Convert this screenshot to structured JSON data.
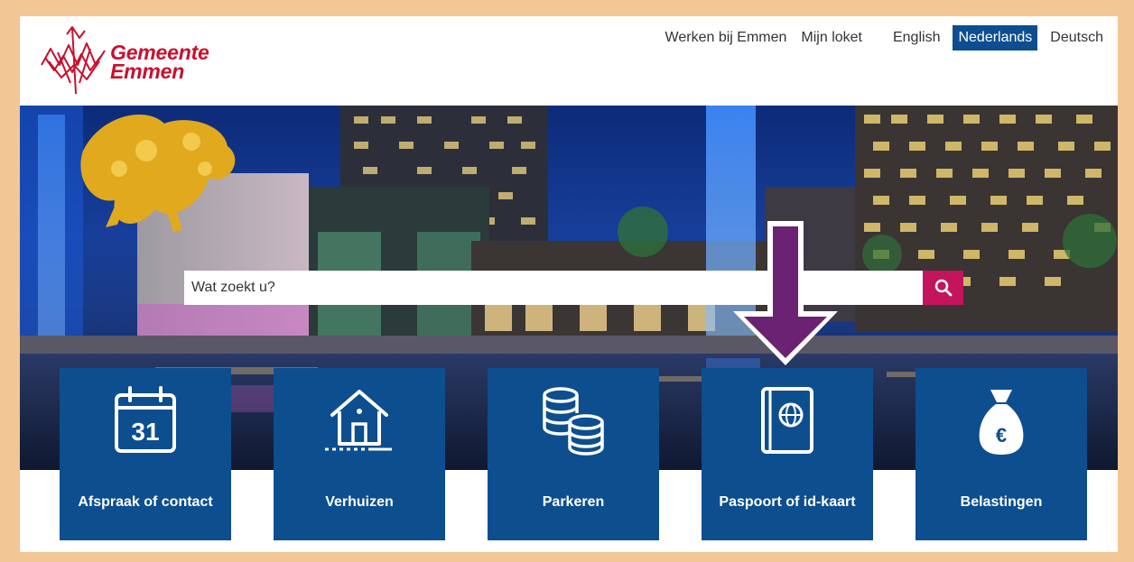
{
  "header": {
    "logo_line1": "Gemeente",
    "logo_line2": "Emmen",
    "links": [
      "Werken bij Emmen",
      "Mijn loket"
    ],
    "languages": [
      {
        "label": "English",
        "active": false
      },
      {
        "label": "Nederlands",
        "active": true
      },
      {
        "label": "Deutsch",
        "active": false
      }
    ]
  },
  "search": {
    "placeholder": "Wat zoekt u?",
    "button_icon": "search-icon"
  },
  "tiles": [
    {
      "label": "Afspraak of contact",
      "icon": "calendar-icon",
      "icon_text": "31"
    },
    {
      "label": "Verhuizen",
      "icon": "house-icon"
    },
    {
      "label": "Parkeren",
      "icon": "coins-icon"
    },
    {
      "label": "Paspoort of id-kaart",
      "icon": "passport-icon"
    },
    {
      "label": "Belastingen",
      "icon": "money-bag-icon",
      "icon_text": "€"
    }
  ],
  "annotation": {
    "icon": "arrow-down-icon",
    "color": "#6b2272"
  },
  "colors": {
    "brand_blue": "#0d4e8f",
    "brand_red": "#c8102e",
    "search_button": "#c4145e",
    "frame_border": "#f2c794"
  }
}
